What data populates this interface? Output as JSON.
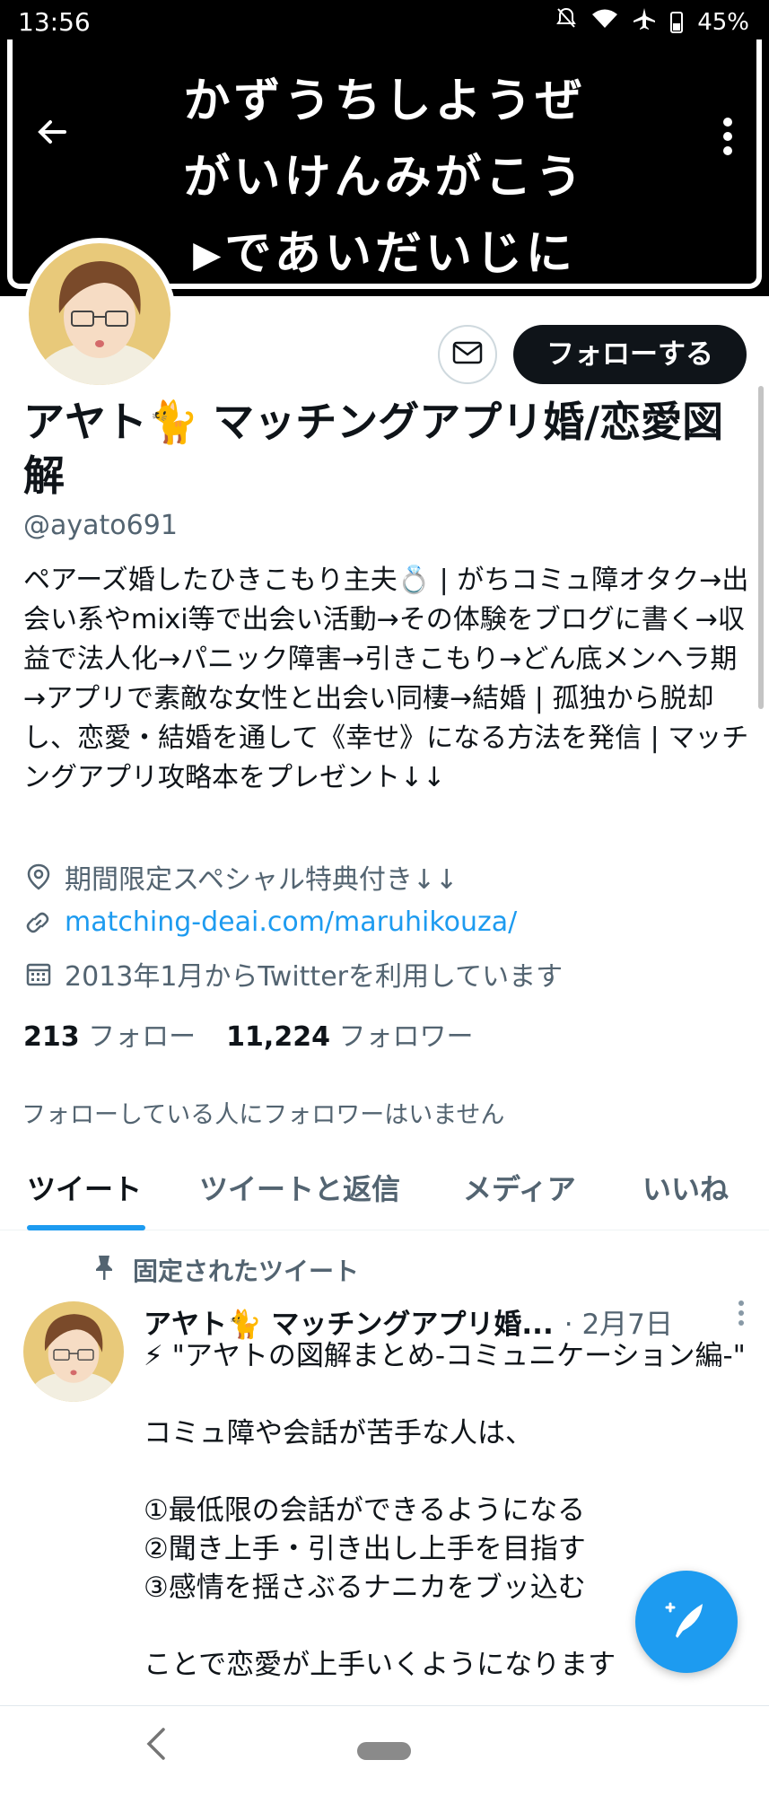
{
  "status_bar": {
    "time": "13:56",
    "battery": "45%",
    "icons": [
      "mute-icon",
      "wifi-icon",
      "airplane-icon",
      "battery-icon"
    ]
  },
  "banner": {
    "lines": [
      "かずうちしようぜ",
      "がいけんみがこう",
      "▶であいだいじに"
    ]
  },
  "profile": {
    "name": "アヤト🐈 マッチングアプリ婚/恋愛図解",
    "handle": "@ayato691",
    "bio": "ペアーズ婚したひきこもり主夫💍 | がちコミュ障オタク→出会い系やmixi等で出会い活動→その体験をブログに書く→収益で法人化→パニック障害→引きこもり→どん底メンヘラ期→アプリで素敵な女性と出会い同棲→結婚 | 孤独から脱却し、恋愛・結婚を通して《幸せ》になる方法を発信 | マッチングアプリ攻略本をプレゼント↓↓",
    "location": "期間限定スペシャル特典付き↓↓",
    "website": "matching-deai.com/maruhikouza/",
    "joined": "2013年1月からTwitterを利用しています",
    "following_count": "213",
    "following_label": "フォロー",
    "followers_count": "11,224",
    "followers_label": "フォロワー",
    "mutuals_note": "フォローしている人にフォロワーはいません",
    "follow_button": "フォローする"
  },
  "tabs": [
    "ツイート",
    "ツイートと返信",
    "メディア",
    "いいね"
  ],
  "active_tab": 0,
  "pinned": {
    "label": "固定されたツイート",
    "author": "アヤト🐈 マッチングアプリ婚...",
    "date": "· 2月7日",
    "body": "⚡ \"アヤトの図解まとめ-コミュニケーション編-\"\n\nコミュ障や会話が苦手な人は、\n\n①最低限の会話ができるようになる\n②聞き上手・引き出し上手を目指す\n③感情を揺さぶるナニカをブッ込む\n\nことで恋愛が上手いくようになります"
  },
  "colors": {
    "accent": "#1d9bf0",
    "text": "#0f1419",
    "secondary": "#536471",
    "banner_bg": "#000000"
  }
}
